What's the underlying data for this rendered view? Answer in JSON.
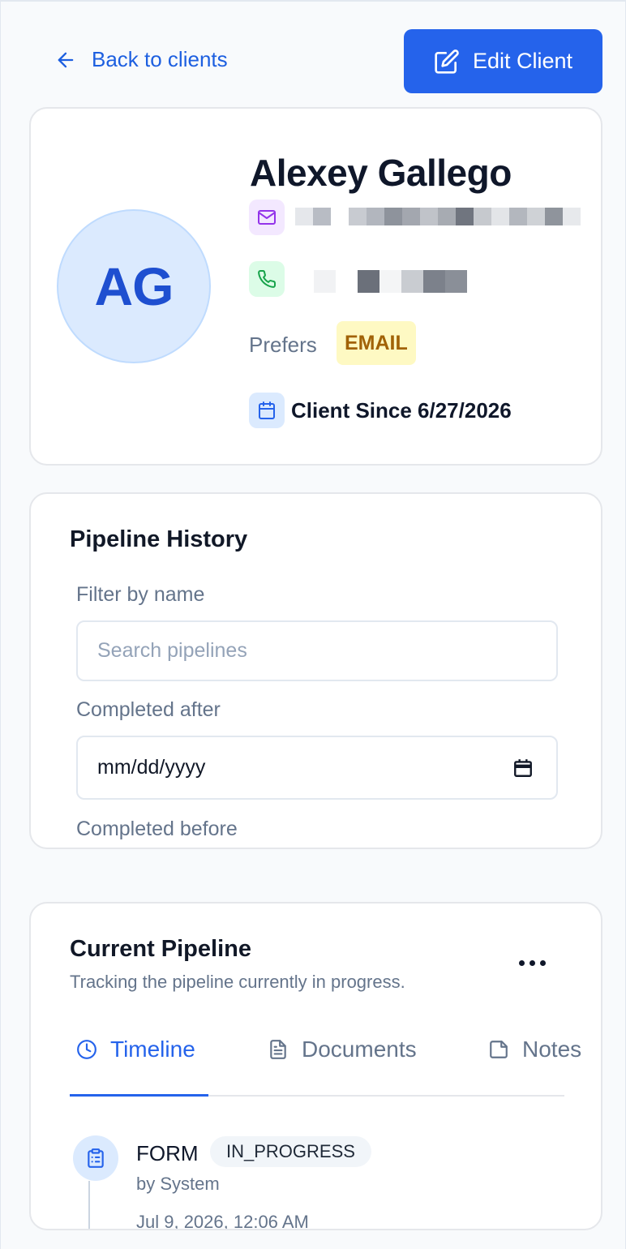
{
  "nav": {
    "back_label": "Back to clients",
    "edit_label": "Edit Client"
  },
  "client": {
    "initials": "AG",
    "name": "Alexey Gallego",
    "prefers_label": "Prefers",
    "preferred_contact": "EMAIL",
    "since": "Client Since 6/27/2026"
  },
  "pipeline_history": {
    "title": "Pipeline History",
    "filter_label": "Filter by name",
    "search_placeholder": "Search pipelines",
    "after_label": "Completed after",
    "date_placeholder": "mm/dd/yyyy",
    "before_label": "Completed before"
  },
  "current_pipeline": {
    "title": "Current Pipeline",
    "subtitle": "Tracking the pipeline currently in progress.",
    "tabs": [
      {
        "label": "Timeline",
        "active": true
      },
      {
        "label": "Documents",
        "active": false
      },
      {
        "label": "Notes",
        "active": false
      }
    ],
    "timeline": [
      {
        "type": "FORM",
        "status": "IN_PROGRESS",
        "by": "by System",
        "date": "Jul 9, 2026, 12:06 AM"
      }
    ]
  },
  "icons": {
    "back": "arrow-left-icon",
    "edit": "edit-icon",
    "email": "mail-icon",
    "phone": "phone-icon",
    "calendar": "calendar-icon",
    "more": "more-horizontal-icon",
    "timeline": "clock-icon",
    "documents": "file-text-icon",
    "notes": "sticky-note-icon",
    "form": "clipboard-list-icon"
  },
  "colors": {
    "primary": "#2563eb",
    "avatar_bg": "#dbeafe",
    "badge_bg": "#fef9c3",
    "badge_text": "#a16207"
  }
}
